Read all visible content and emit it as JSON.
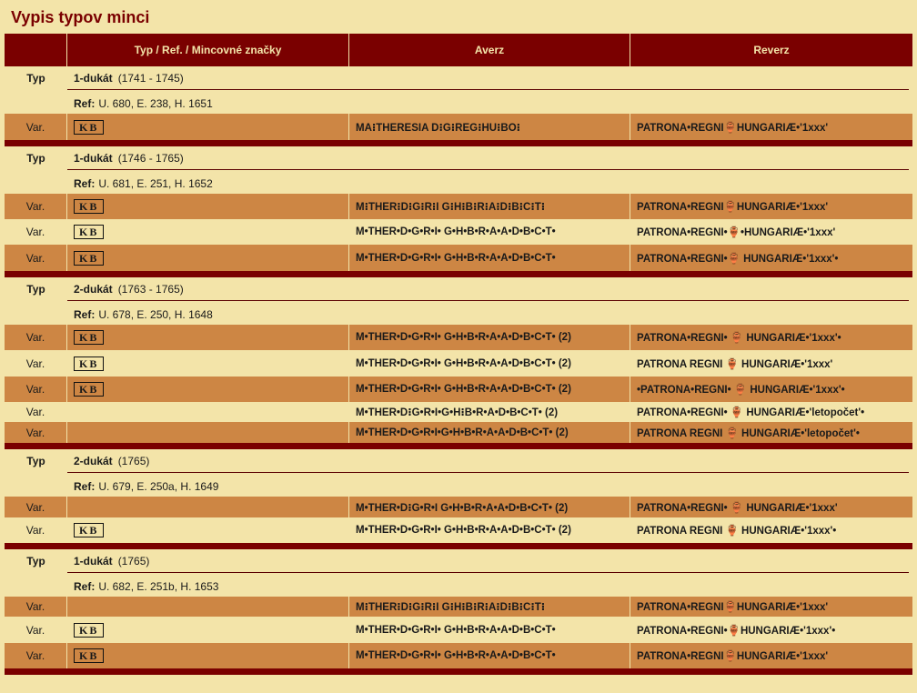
{
  "title": "Vypis typov minci",
  "headers": [
    "",
    "Typ / Ref. / Mincovné značky",
    "Averz",
    "Reverz"
  ],
  "labels": {
    "typ": "Typ",
    "ref": "Ref:"
  },
  "groups": [
    {
      "name": "1-dukát",
      "years": "(1741 - 1745)",
      "ref": "U. 680, E. 238, H. 1651",
      "vars": [
        {
          "label": "Var.",
          "mark": "KB",
          "averz": "MA⁝THERESIA D⁝G⁝REG⁝HU⁝BO⁝",
          "reverz": "PATRONA•REGNI🏺HUNGARIÆ•'1xxx'",
          "h": 29
        }
      ]
    },
    {
      "name": "1-dukát",
      "years": "(1746 - 1765)",
      "ref": "U. 681, E. 251, H. 1652",
      "vars": [
        {
          "label": "Var.",
          "mark": "KB",
          "averz": "M⁝THER⁝D⁝G⁝R⁝I G⁝H⁝B⁝R⁝A⁝D⁝B⁝C⁝T⁝",
          "reverz": "PATRONA•REGNI🏺HUNGARIÆ•'1xxx'",
          "h": 28
        },
        {
          "label": "Var.",
          "mark": "KB",
          "averz": "M•THER•D•G•R•I• G•H•B•R•A•A•D•B•C•T•",
          "reverz": "PATRONA•REGNI•🏺•HUNGARIÆ•'1xxx'",
          "h": 28
        },
        {
          "label": "Var.",
          "mark": "KB",
          "averz": "M•THER•D•G•R•I• G•H•B•R•A•A•D•B•C•T•",
          "reverz": "PATRONA•REGNI•🏺 HUNGARIÆ•'1xxx'•",
          "h": 29
        }
      ]
    },
    {
      "name": "2-dukát",
      "years": "(1763 - 1765)",
      "ref": "U. 678, E. 250, H. 1648",
      "vars": [
        {
          "label": "Var.",
          "mark": "KB",
          "averz": "M•THER•D•G•R•I• G•H•B•R•A•A•D•B•C•T• (2)",
          "reverz": "PATRONA•REGNI• 🏺 HUNGARIÆ•'1xxx'•",
          "h": 28
        },
        {
          "label": "Var.",
          "mark": "KB",
          "averz": "M•THER•D•G•R•I• G•H•B•R•A•A•D•B•C•T• (2)",
          "reverz": "PATRONA REGNI 🏺 HUNGARIÆ•'1xxx'",
          "h": 29
        },
        {
          "label": "Var.",
          "mark": "KB",
          "averz": "M•THER•D•G•R•I• G•H•B•R•A•A•D•B•C•T• (2)",
          "reverz": "•PATRONA•REGNI• 🏺 HUNGARIÆ•'1xxx'•",
          "h": 28
        },
        {
          "label": "Var.",
          "mark": "",
          "averz": "M•THER•D⁝G•R•I•G•H⁝B•R•A•D•B•C•T• (2)",
          "reverz": "PATRONA•REGNI• 🏺 HUNGARIÆ•'letopočet'•",
          "h": 22
        },
        {
          "label": "Var.",
          "mark": "",
          "averz": "M•THER•D•G•R•I•G•H•B•R•A•A•D•B•C•T• (2)",
          "reverz": "PATRONA REGNI 🏺 HUNGARIÆ•'letopočet'•",
          "h": 23
        }
      ]
    },
    {
      "name": "2-dukát",
      "years": "(1765)",
      "ref": "U. 679, E. 250a, H. 1649",
      "vars": [
        {
          "label": "Var.",
          "mark": "",
          "averz": "M•THER•D⁝G•R•I G•H•B•R•A•A•D•B•C•T• (2)",
          "reverz": "PATRONA•REGNI• 🏺 HUNGARIÆ•'1xxx'",
          "h": 23
        },
        {
          "label": "Var.",
          "mark": "KB",
          "averz": "M•THER•D•G•R•I• G•H•B•R•A•A•D•B•C•T• (2)",
          "reverz": "PATRONA REGNI 🏺 HUNGARIÆ•'1xxx'•",
          "h": 28
        }
      ]
    },
    {
      "name": "1-dukát",
      "years": "(1765)",
      "ref": "U. 682, E. 251b, H. 1653",
      "vars": [
        {
          "label": "Var.",
          "mark": "",
          "averz": "M⁝THER⁝D⁝G⁝R⁝I G⁝H⁝B⁝R⁝A⁝D⁝B⁝C⁝T⁝",
          "reverz": "PATRONA•REGNI🏺HUNGARIÆ•'1xxx'",
          "h": 22
        },
        {
          "label": "Var.",
          "mark": "KB",
          "averz": "M•THER•D•G•R•I• G•H•B•R•A•A•D•B•C•T•",
          "reverz": "PATRONA•REGNI•🏺HUNGARIÆ•'1xxx'•",
          "h": 29
        },
        {
          "label": "Var.",
          "mark": "KB",
          "averz": "M•THER•D•G•R•I• G•H•B•R•A•A•D•B•C•T•",
          "reverz": "PATRONA•REGNI🏺HUNGARIÆ•'1xxx'",
          "h": 28
        }
      ]
    }
  ]
}
